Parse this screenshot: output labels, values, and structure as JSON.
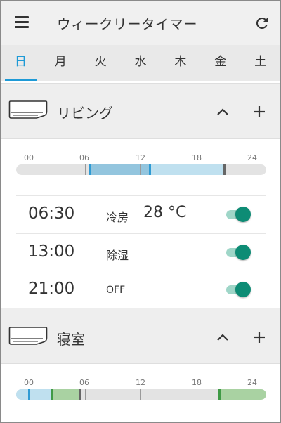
{
  "app": {
    "title": "ウィークリータイマー"
  },
  "tabs": [
    {
      "label": "日",
      "active": true
    },
    {
      "label": "月"
    },
    {
      "label": "火"
    },
    {
      "label": "水"
    },
    {
      "label": "木"
    },
    {
      "label": "金"
    },
    {
      "label": "土"
    }
  ],
  "devices": [
    {
      "name": "リビング",
      "timeline": {
        "ticks": [
          "00",
          "06",
          "12",
          "18",
          "24"
        ],
        "segments": [
          {
            "from": 6.5,
            "to": 13,
            "color": "#93c5de"
          },
          {
            "from": 13,
            "to": 21,
            "color": "#bfe0ef"
          }
        ],
        "markers": [
          {
            "at": 6.5,
            "color": "#2f9bd4"
          },
          {
            "at": 13,
            "color": "#2f9bd4"
          },
          {
            "at": 21,
            "color": "#666666"
          }
        ]
      },
      "schedules": [
        {
          "time": "06:30",
          "mode": "冷房",
          "temp": "28 °C",
          "enabled": true
        },
        {
          "time": "13:00",
          "mode": "除湿",
          "temp": "",
          "enabled": true
        },
        {
          "time": "21:00",
          "mode": "OFF",
          "temp": "",
          "enabled": true
        }
      ]
    },
    {
      "name": "寝室",
      "timeline": {
        "ticks": [
          "00",
          "06",
          "12",
          "18",
          "24"
        ],
        "segments": [
          {
            "from": 0,
            "to": 2.5,
            "color": "#bfe0ef"
          },
          {
            "from": 2.5,
            "to": 5.5,
            "color": "#a9d2a2"
          },
          {
            "from": 20.5,
            "to": 24,
            "color": "#a9d2a2"
          }
        ],
        "markers": [
          {
            "at": 0,
            "color": "#2f9bd4"
          },
          {
            "at": 2.5,
            "color": "#3f9a45"
          },
          {
            "at": 5.5,
            "color": "#666666"
          },
          {
            "at": 20.5,
            "color": "#3f9a45"
          }
        ]
      }
    }
  ],
  "colors": {
    "accent": "#1e9ad6",
    "toggle_on": "#0d8c75",
    "toggle_track": "#9fd6c8"
  }
}
